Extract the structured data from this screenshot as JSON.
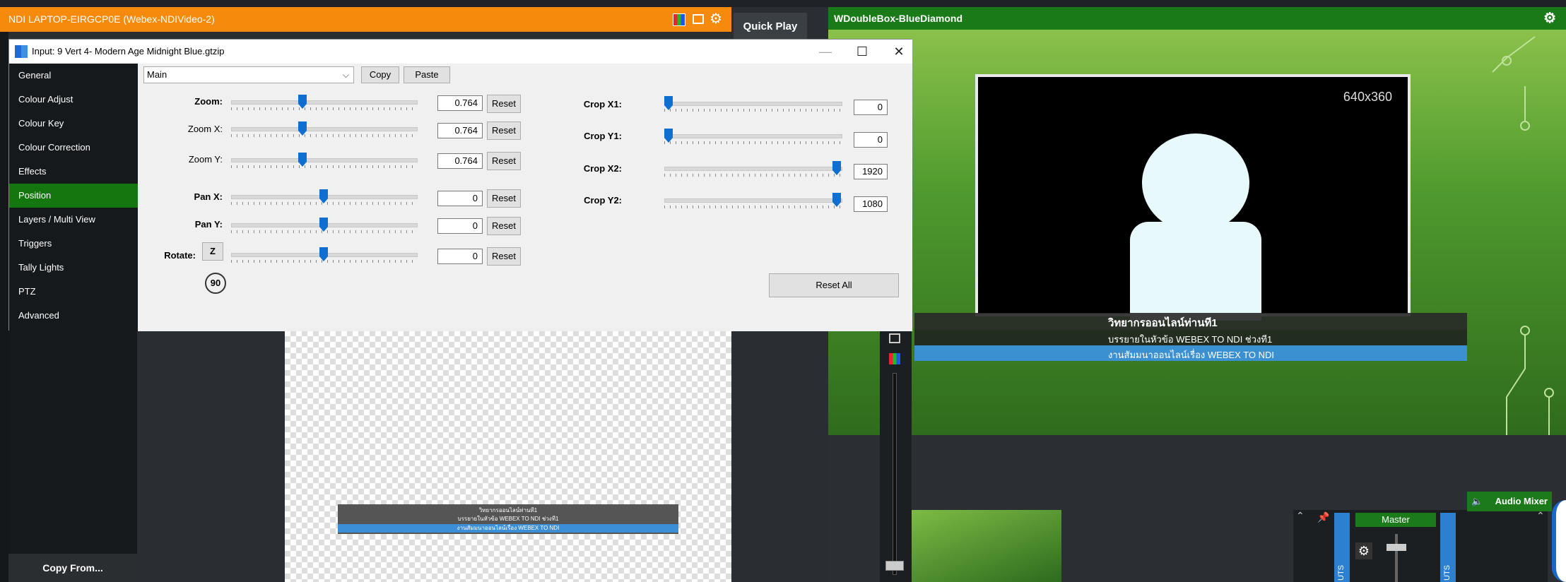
{
  "preview_bar": {
    "title": "NDI LAPTOP-EIRGCP0E (Webex-NDIVideo-2)"
  },
  "quick_play": {
    "label": "Quick Play"
  },
  "output_bar": {
    "title": "WDoubleBox-BlueDiamond"
  },
  "output": {
    "resolution": "640x360",
    "lower_third": {
      "line1": "วิทยากรออนไลน์ท่านที1",
      "line2": "บรรยายในหัวข้อ  WEBEX TO NDI ช่วงที1",
      "line3": "งานสัมมนาออนไลน์เรื่อง WEBEX TO NDI"
    }
  },
  "preview_mini": {
    "line1": "วิทยากรออนไลน์ท่านที1",
    "line2": "บรรยายในหัวข้อ  WEBEX TO NDI ช่วงที1",
    "line3": "งานสัมมนาออนไลน์เรื่อง WEBEX TO NDI"
  },
  "dialog": {
    "title": "Input: 9 Vert 4- Modern Age Midnight Blue.gtzip",
    "minimize": "—",
    "maximize": "☐",
    "close": "✕",
    "nav": [
      "General",
      "Colour Adjust",
      "Colour Key",
      "Colour Correction",
      "Effects",
      "Position",
      "Layers / Multi View",
      "Triggers",
      "Tally Lights",
      "PTZ",
      "Advanced"
    ],
    "active_nav": "Position",
    "layer_select": "Main",
    "copy_label": "Copy",
    "paste_label": "Paste",
    "reset_label": "Reset",
    "reset_all_label": "Reset All",
    "rotate_z_label": "Z",
    "rotate_90_label": "90",
    "copy_from_label": "Copy From...",
    "position": {
      "zoom": {
        "label": "Zoom:",
        "value": "0.764",
        "fraction": 0.38
      },
      "zoom_x": {
        "label": "Zoom X:",
        "value": "0.764",
        "fraction": 0.38
      },
      "zoom_y": {
        "label": "Zoom Y:",
        "value": "0.764",
        "fraction": 0.38
      },
      "pan_x": {
        "label": "Pan X:",
        "value": "0",
        "fraction": 0.5
      },
      "pan_y": {
        "label": "Pan Y:",
        "value": "0",
        "fraction": 0.5
      },
      "rotate": {
        "label": "Rotate:",
        "value": "0",
        "fraction": 0.5
      }
    },
    "crop": {
      "x1": {
        "label": "Crop X1:",
        "value": "0",
        "fraction": 0
      },
      "y1": {
        "label": "Crop Y1:",
        "value": "0",
        "fraction": 0
      },
      "x2": {
        "label": "Crop X2:",
        "value": "1920",
        "fraction": 1
      },
      "y2": {
        "label": "Crop Y2:",
        "value": "1080",
        "fraction": 1
      }
    }
  },
  "audio_mixer": {
    "label": "Audio Mixer",
    "master_label": "Master",
    "strip_label": "UTS"
  },
  "colors": {
    "preview_bar": "#f58a0c",
    "output_bar": "#1a7a18",
    "active_nav": "#13760f",
    "slider_thumb": "#0f6fd0"
  }
}
